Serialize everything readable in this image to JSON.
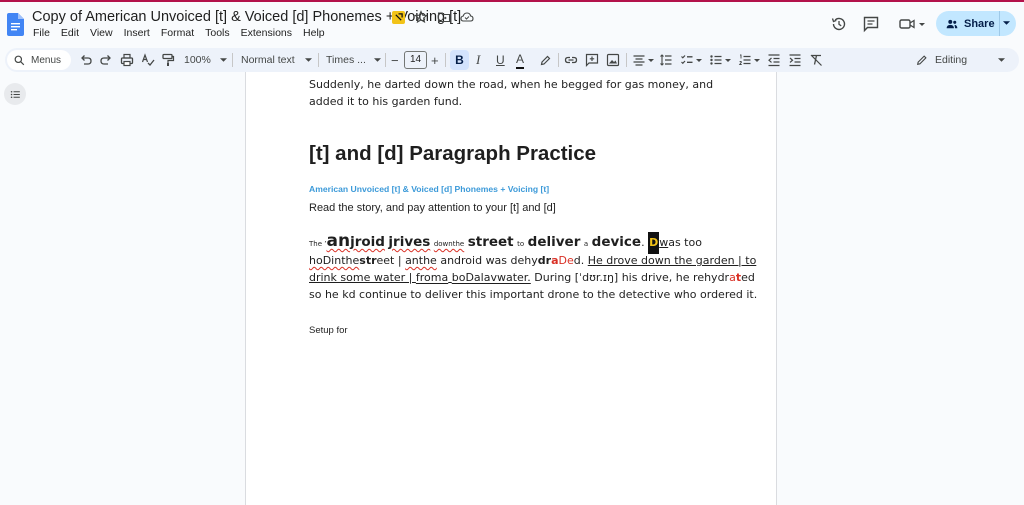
{
  "titlebar": {
    "doc_title": "Copy of American Unvoiced [t] & Voiced [d] Phonemes + Voicing [t]",
    "icons": [
      "doc-logo-icon",
      "badge-icon",
      "star-icon",
      "move-folder-icon",
      "cloud-status-icon"
    ],
    "menus": [
      "File",
      "Edit",
      "View",
      "Insert",
      "Format",
      "Tools",
      "Extensions",
      "Help"
    ],
    "share_label": "Share",
    "right_icons": [
      "history-icon",
      "comments-icon",
      "meet-icon",
      "chevron-down-icon"
    ]
  },
  "toolbar": {
    "search_label": "Menus",
    "zoom": "100%",
    "style": "Normal text",
    "font": "Times ...",
    "font_size": "14",
    "minus": "−",
    "plus": "+",
    "bold": "B",
    "italic": "I",
    "underline": "U",
    "text_color": "A",
    "mode": "Editing"
  },
  "document": {
    "para1": "Suddenly, he darted down the road, when he begged for gas money, and added it to his garden fund.",
    "heading": "[t] and [d] Paragraph Practice",
    "subtitle": "American Unvoiced [t] & Voiced [d] Phonemes + Voicing [t]",
    "instruction": "Read the story, and pay attention to your [t] and [d]",
    "story": {
      "s_the": "The ",
      "s_apos": "’",
      "s_an": "an",
      "s_jroid": "jroid",
      "s_jrives": "jrives",
      "s_downthe": "downthe",
      "s_street": "street",
      "s_to": "to",
      "s_deliver": "deliver",
      "s_a": "a",
      "s_device": "device",
      "s_dot": ".",
      "s_cursor": "D",
      "s_w": "w",
      "s_astoo": "as too",
      "s_hodin": "hoDinthe",
      "s_str": "str",
      "s_eet": "eet | ",
      "s_anthe": "anthe",
      "s_android": " android was dehy",
      "s_dr": "dr",
      "s_a2": "a",
      "s_De": "De",
      "s_d": "d. ",
      "s_drove": "He drove down the garden | to",
      "s_drink": "drink some water | ",
      "s_froma": "froma",
      "s_space": " ",
      "s_boda": "boDalavwater.",
      "s_during": " During [ˈdʊr.ɪŋ] his drive, he rehydr",
      "s_a3": "a",
      "s_t": "t",
      "s_ed": "ed",
      "s_last": "so he kd continue to deliver this important drone to the detective who ordered it."
    },
    "setup": "Setup for"
  }
}
